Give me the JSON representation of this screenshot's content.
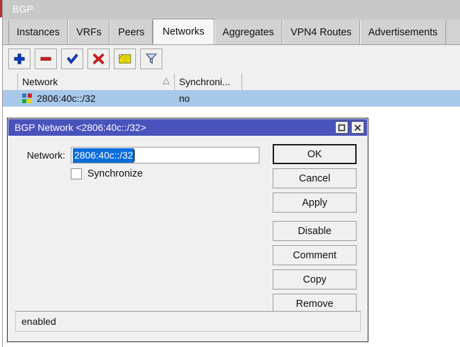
{
  "window": {
    "title": "BGP"
  },
  "tabs": [
    {
      "label": "Instances",
      "active": false
    },
    {
      "label": "VRFs",
      "active": false
    },
    {
      "label": "Peers",
      "active": false
    },
    {
      "label": "Networks",
      "active": true
    },
    {
      "label": "Aggregates",
      "active": false
    },
    {
      "label": "VPN4 Routes",
      "active": false
    },
    {
      "label": "Advertisements",
      "active": false
    }
  ],
  "toolbar": {
    "buttons": [
      {
        "name": "add-button",
        "icon": "plus-icon",
        "color": "#0a3fd0"
      },
      {
        "name": "remove-button",
        "icon": "minus-icon",
        "color": "#d81414"
      },
      {
        "name": "enable-button",
        "icon": "check-icon",
        "color": "#1540c8"
      },
      {
        "name": "disable-button",
        "icon": "cross-icon",
        "color": "#d81414"
      },
      {
        "name": "comment-button",
        "icon": "note-icon",
        "color": "#f2e400"
      },
      {
        "name": "filter-button",
        "icon": "funnel-icon",
        "color": "#7f9fd4"
      }
    ]
  },
  "table": {
    "columns": [
      {
        "key": "network",
        "label": "Network",
        "sorted": "asc"
      },
      {
        "key": "sync",
        "label": "Synchroni...",
        "sorted": ""
      }
    ],
    "rows": [
      {
        "network": "2806:40c::/32",
        "sync": "no",
        "selected": true
      }
    ],
    "row_icon_colors": [
      "#3a74c4",
      "#cc2222",
      "#22aa33",
      "#e8d400"
    ]
  },
  "dialog": {
    "title": "BGP Network <2806:40c::/32>",
    "maximize_glyph": "□",
    "close_glyph": "✕",
    "network_label": "Network:",
    "network_value": "2806:40c::/32",
    "network_placeholder": "",
    "synchronize_label": "Synchronize",
    "synchronize_checked": false,
    "buttons": [
      {
        "label": "OK",
        "focused": true,
        "gap_above": false
      },
      {
        "label": "Cancel",
        "focused": false,
        "gap_above": false
      },
      {
        "label": "Apply",
        "focused": false,
        "gap_above": false
      },
      {
        "label": "Disable",
        "focused": false,
        "gap_above": true
      },
      {
        "label": "Comment",
        "focused": false,
        "gap_above": false
      },
      {
        "label": "Copy",
        "focused": false,
        "gap_above": false
      },
      {
        "label": "Remove",
        "focused": false,
        "gap_above": false
      }
    ],
    "status": "enabled"
  },
  "colors": {
    "title_bar": "#c8c8c8",
    "dialog_title_bar": "#4a52bc",
    "selection_row": "#a8c8ea",
    "text_selection": "#0a6ddc",
    "surface": "#f0f0f0"
  }
}
